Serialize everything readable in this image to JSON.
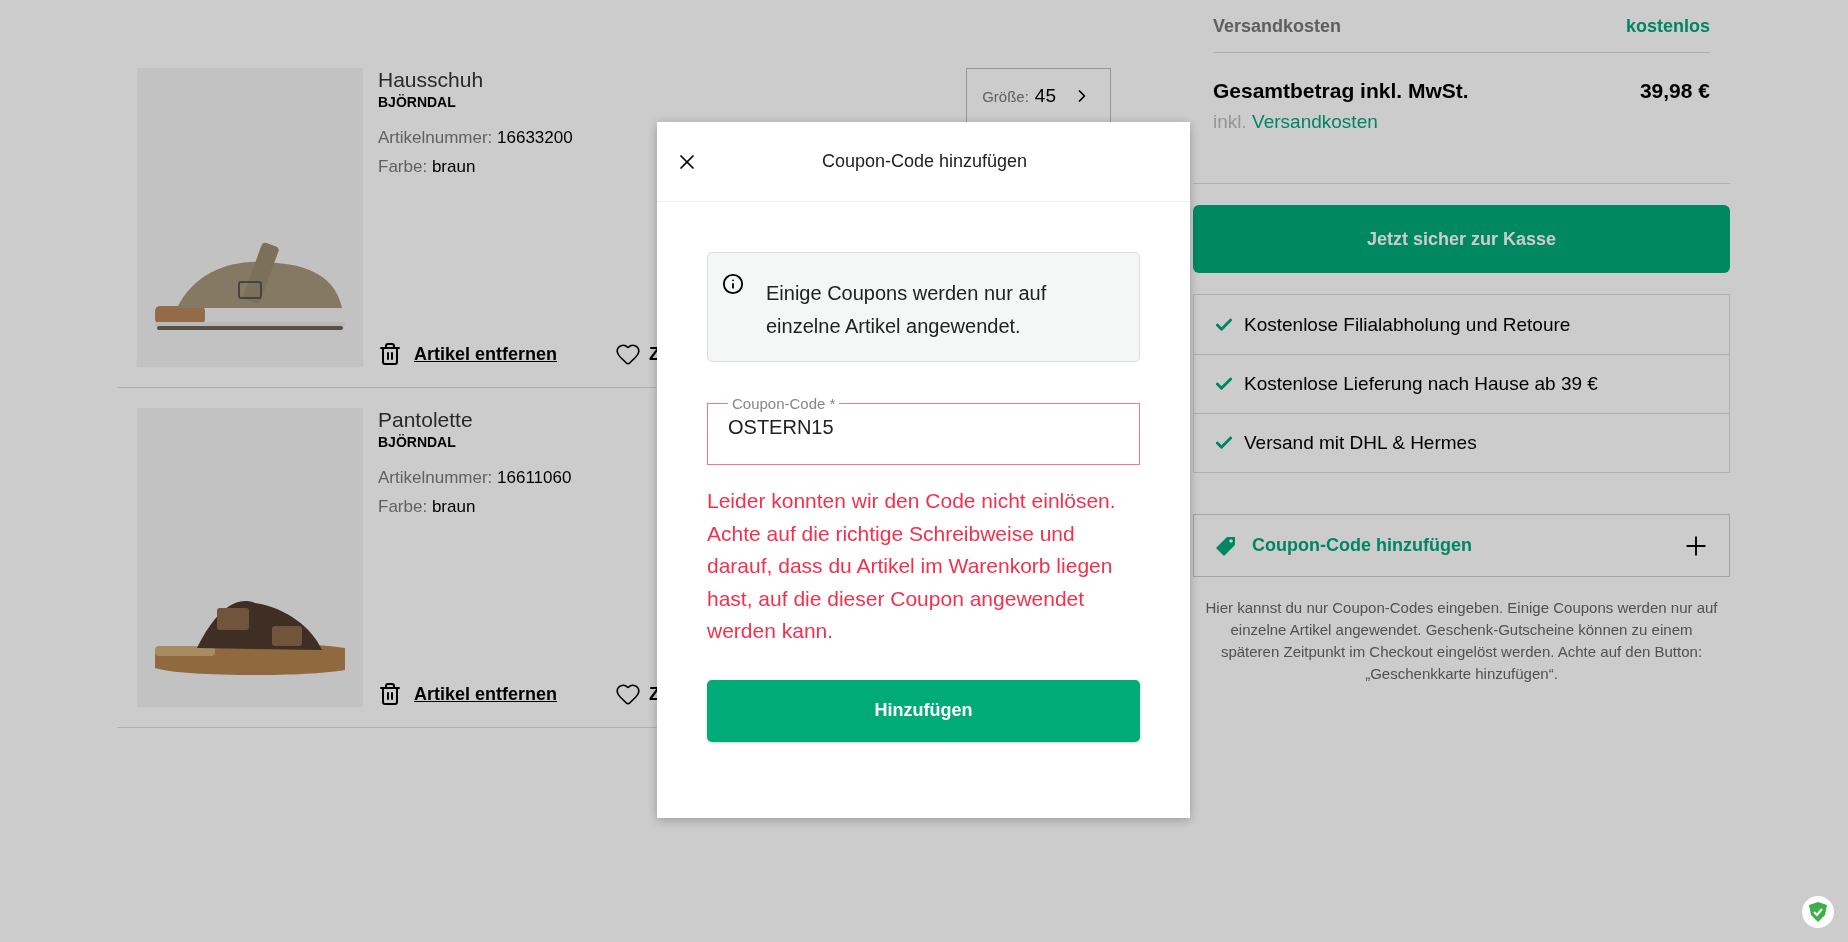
{
  "cart_items": [
    {
      "type": "Hausschuh",
      "brand": "BJÖRNDAL",
      "article_label": "Artikelnummer:",
      "article_number": "16633200",
      "color_label": "Farbe:",
      "color_value": "braun",
      "size": {
        "label": "Größe:",
        "value": "45"
      },
      "remove_link": "Artikel entfernen",
      "wishlist_link": "Z"
    },
    {
      "type": "Pantolette",
      "brand": "BJÖRNDAL",
      "article_label": "Artikelnummer:",
      "article_number": "16611060",
      "color_label": "Farbe:",
      "color_value": "braun",
      "remove_link": "Artikel entfernen",
      "wishlist_link": "Z"
    }
  ],
  "summary": {
    "shipping_label": "Versandkosten",
    "shipping_value": "kostenlos",
    "total_label": "Gesamtbetrag inkl. MwSt.",
    "total_value": "39,98 €",
    "tax_prefix": "inkl.",
    "tax_link": "Versandkosten",
    "checkout_button": "Jetzt sicher zur Kasse",
    "benefits": [
      "Kostenlose Filialabholung und Retoure",
      "Kostenlose Lieferung nach Hause ab 39 €",
      "Versand mit DHL & Hermes"
    ],
    "coupon_toggle": "Coupon-Code hinzufügen",
    "coupon_note": "Hier kannst du nur Coupon-Codes eingeben. Einige Coupons werden nur auf einzelne Artikel angewendet. Geschenk-Gutscheine können zu einem späteren Zeitpunkt im Checkout eingelöst werden. Achte auf den Button: „Geschenkkarte hinzufügen“."
  },
  "modal": {
    "title": "Coupon-Code hinzufügen",
    "info": "Einige Coupons werden nur auf einzelne Artikel angewendet.",
    "coupon_field": {
      "label": "Coupon-Code *",
      "value": "OSTERN15",
      "invalid": true
    },
    "error": "Leider konnten wir den Code nicht einlösen. Achte auf die richtige Schreibweise und darauf, dass du Artikel im Warenkorb liegen hast, auf die dieser Coupon angewendet werden kann.",
    "submit_button": "Hinzufügen"
  }
}
